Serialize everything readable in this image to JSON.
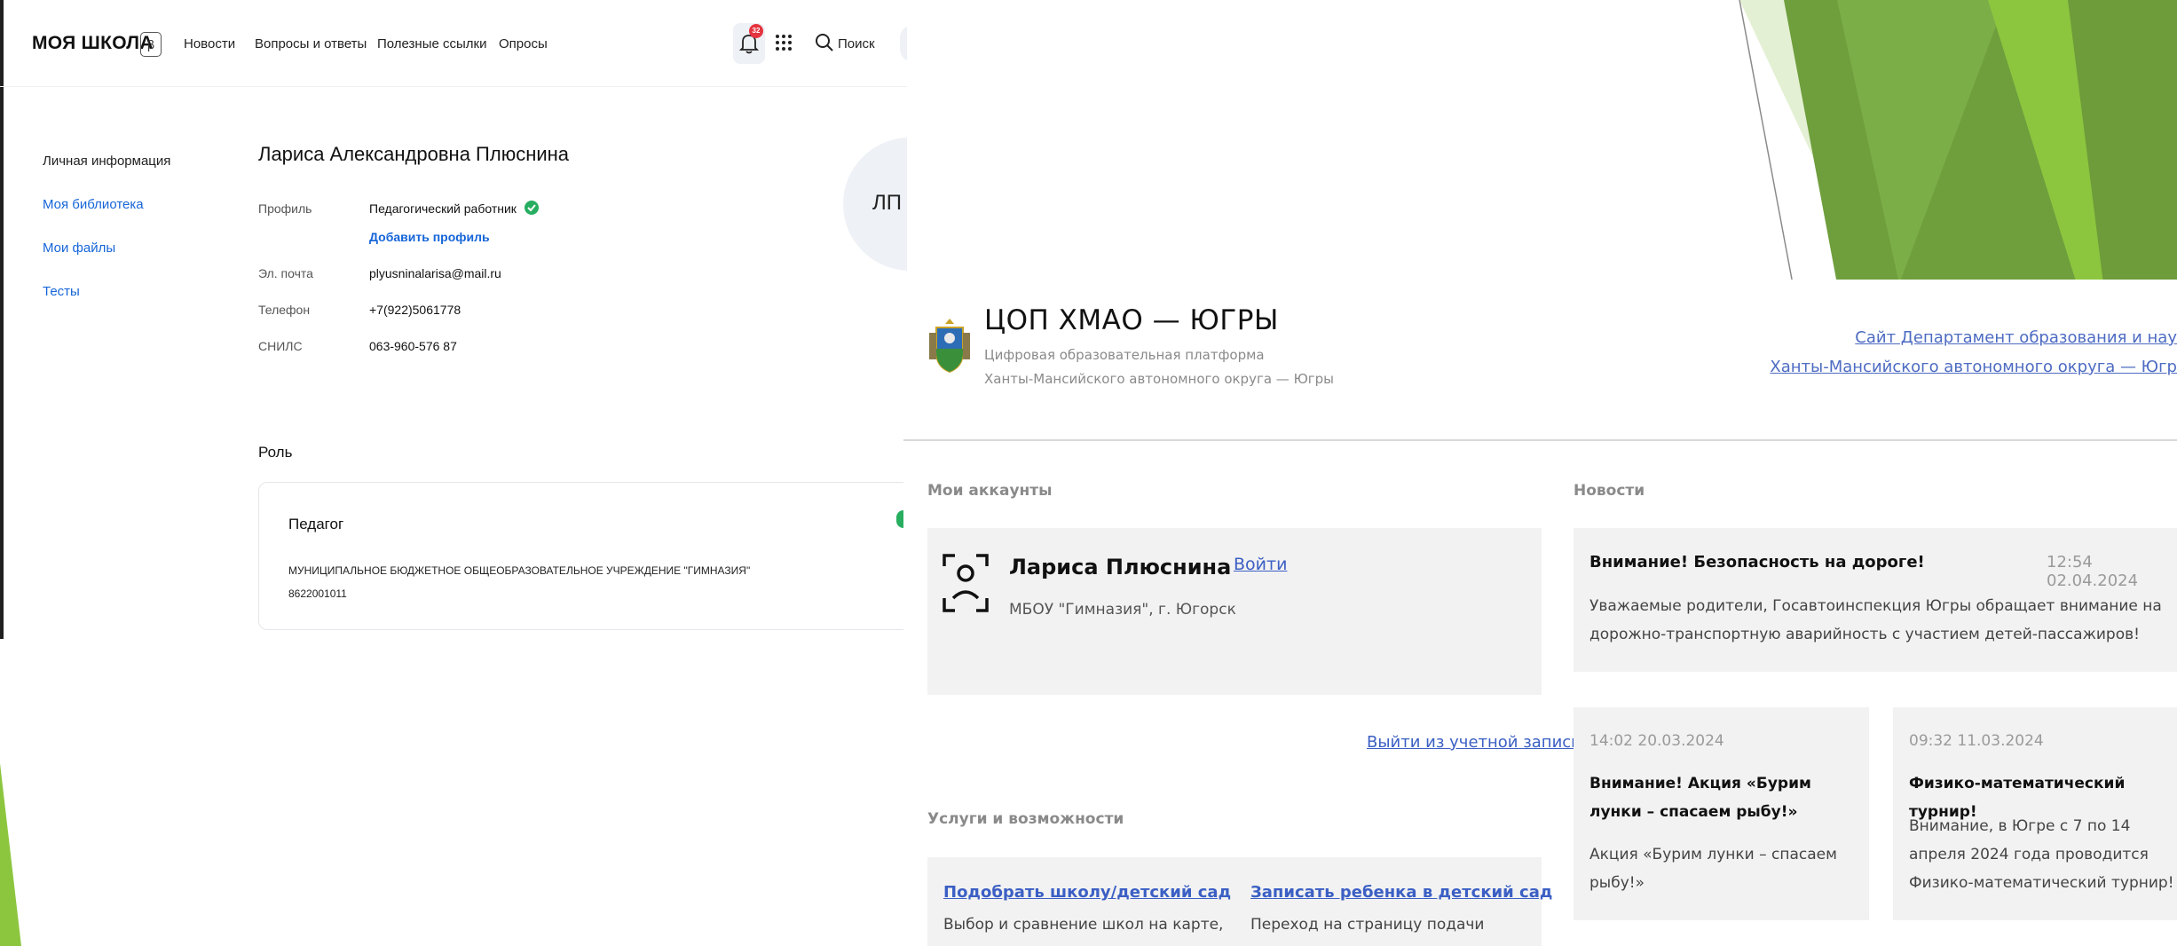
{
  "moya_shkola": {
    "logo": "МОЯ ШКОЛА",
    "beta_badge": "β",
    "nav": [
      "Новости",
      "Вопросы и ответы",
      "Полезные ссылки",
      "Опросы"
    ],
    "notifications_count": "32",
    "search_label": "Поиск",
    "sidebar": [
      "Личная информация",
      "Моя библиотека",
      "Мои файлы",
      "Тесты"
    ],
    "profile": {
      "name": "Лариса Александровна Плюснина",
      "avatar_initials": "ЛП",
      "profile_label": "Профиль",
      "profile_value": "Педагогический работник",
      "add_profile": "Добавить профиль",
      "email_label": "Эл. почта",
      "email_value": "plyusninalarisa@mail.ru",
      "phone_label": "Телефон",
      "phone_value": "+7(922)5061778",
      "snils_label": "СНИЛС",
      "snils_value": "063-960-576 87"
    },
    "role": {
      "title": "Роль",
      "name": "Педагог",
      "org_line1": "МУНИЦИПАЛЬНОЕ БЮДЖЕТНОЕ ОБЩЕОБРАЗОВАТЕЛЬНОЕ УЧРЕЖДЕНИЕ \"ГИМНАЗИЯ\"",
      "org_line2": "8622001011"
    }
  },
  "cop": {
    "title": "ЦОП ХМАО — ЮГРЫ",
    "subtitle1": "Цифровая образовательная платформа",
    "subtitle2": "Ханты-Мансийского автономного округа — Югры",
    "dept_link1": "Сайт Департамент образования и нау",
    "dept_link2": "Ханты-Мансийского автономного округа — Югр",
    "accounts_title": "Мои аккаунты",
    "account": {
      "name": "Лариса Плюснина",
      "login": "Войти",
      "school": "МБОУ \"Гимназия\", г. Югорск"
    },
    "logout": "Выйти из учетной записи",
    "services_title": "Услуги и возможности",
    "services": [
      {
        "link": "Подобрать школу/детский сад",
        "text": "Выбор и сравнение школ на карте,"
      },
      {
        "link": "Записать ребенка в детский сад",
        "text": "Переход на страницу подачи"
      }
    ],
    "news_title": "Новости",
    "news_main": {
      "title": "Внимание! Безопасность на дороге!",
      "time": "12:54 02.04.2024",
      "text": "Уважаемые родители, Госавтоинспекция Югры обращает внимание на дорожно-транспортную аварийность с участием детей-пассажиров!"
    },
    "news_cards": [
      {
        "time": "14:02 20.03.2024",
        "title": "Внимание! Акция «Бурим лунки – спасаем рыбу!»",
        "text": "Акция «Бурим лунки – спасаем рыбу!»"
      },
      {
        "time": "09:32 11.03.2024",
        "title": "Физико-математический турнир!",
        "text": "Внимание, в Югре с 7 по 14 апреля 2024 года проводится Физико-математический турнир!"
      }
    ]
  },
  "colors": {
    "accent_green": "#8cc63f",
    "link_blue": "#1565d8",
    "cop_link": "#3b5fc4"
  }
}
